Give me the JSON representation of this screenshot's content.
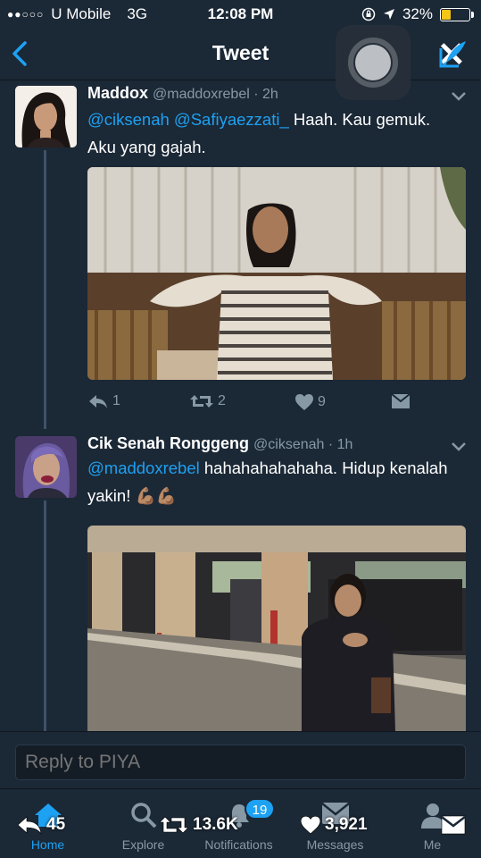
{
  "status_bar": {
    "carrier": "U Mobile",
    "network": "3G",
    "time": "12:08 PM",
    "battery": "32%",
    "battery_level": 0.32
  },
  "nav": {
    "title": "Tweet",
    "close_glyph": "✕"
  },
  "tweets": [
    {
      "name": "Maddox",
      "handle": "@maddoxrebel",
      "time": "2h",
      "text_mentions": "@ciksenah @Safiyaezzati_",
      "text_body": " Haah. Kau gemuk. Aku yang gajah.",
      "actions": {
        "replies": "1",
        "retweets": "2",
        "likes": "9"
      }
    },
    {
      "name": "Cik Senah Ronggeng",
      "handle": "@ciksenah",
      "time": "1h",
      "text_mentions": "@maddoxrebel",
      "text_body": " hahahahahahaha. Hidup kenalah yakin! 💪🏽💪🏽"
    }
  ],
  "reply": {
    "placeholder": "Reply to PIYA"
  },
  "tab_bar": {
    "tabs": [
      {
        "label": "Home",
        "icon": "home-icon"
      },
      {
        "label": "Explore",
        "icon": "search-icon"
      },
      {
        "label": "Notifications",
        "icon": "bell-icon"
      },
      {
        "label": "Messages",
        "icon": "mail-icon"
      },
      {
        "label": "Me",
        "icon": "person-icon"
      }
    ],
    "notification_badge": "19"
  },
  "overlay_stats": {
    "replies": "45",
    "retweets": "13.6K",
    "likes": "3,921"
  },
  "colors": {
    "background": "#1b2836",
    "accent": "#1da1f2",
    "muted": "#8899a6"
  }
}
